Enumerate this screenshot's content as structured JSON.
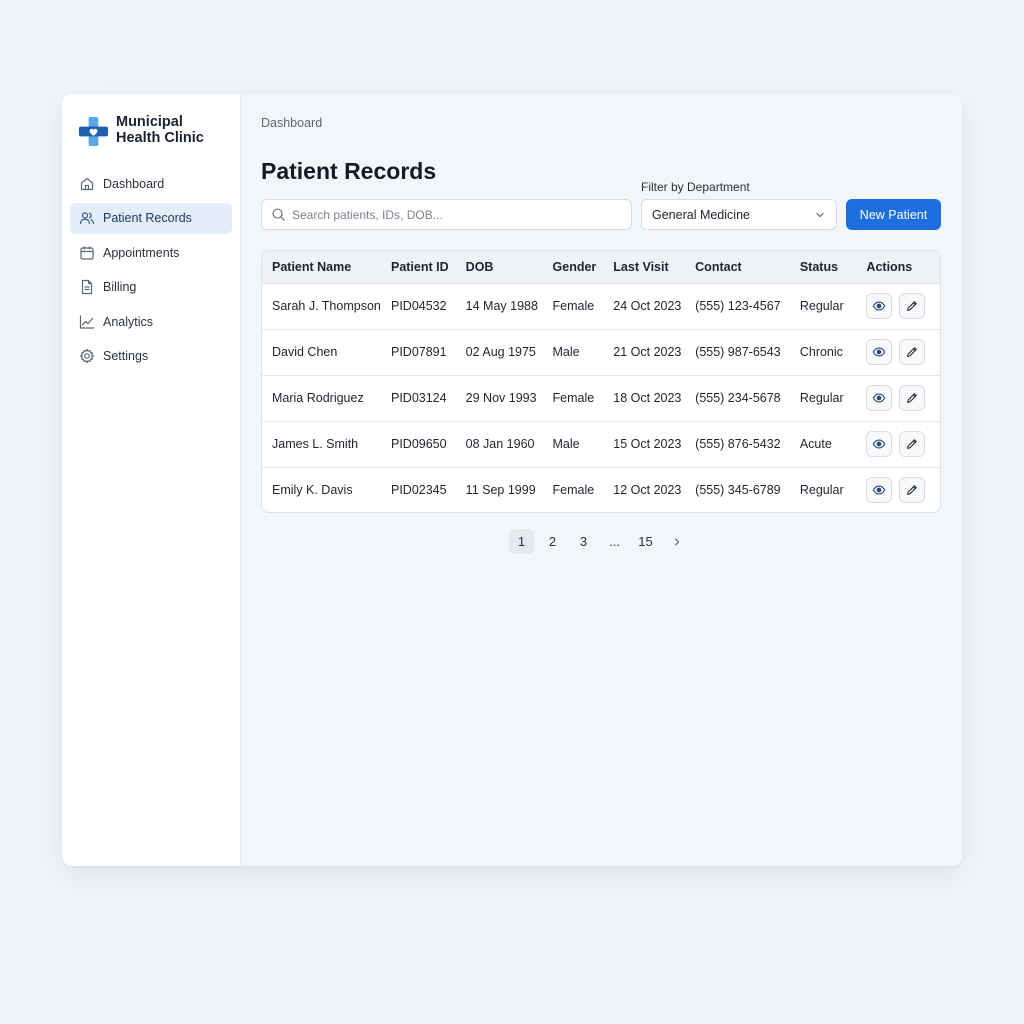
{
  "brand": {
    "name_line1": "Municipal",
    "name_line2": "Health Clinic"
  },
  "sidebar": {
    "items": [
      {
        "label": "Dashboard",
        "icon": "home-icon"
      },
      {
        "label": "Patient Records",
        "icon": "users-icon",
        "active": true
      },
      {
        "label": "Appointments",
        "icon": "calendar-icon"
      },
      {
        "label": "Billing",
        "icon": "document-icon"
      },
      {
        "label": "Analytics",
        "icon": "chart-line-icon"
      },
      {
        "label": "Settings",
        "icon": "gear-icon"
      }
    ]
  },
  "main": {
    "breadcrumb": "Dashboard",
    "title": "Patient Records",
    "search": {
      "placeholder": "Search patients, IDs, DOB...",
      "value": ""
    },
    "filter": {
      "label": "Filter by Department",
      "selected": "General Medicine"
    },
    "new_button": "New Patient"
  },
  "table": {
    "columns": [
      "Patient Name",
      "Patient ID",
      "DOB",
      "Gender",
      "Last Visit",
      "Contact",
      "Status",
      "Actions"
    ],
    "rows": [
      {
        "name": "Sarah J. Thompson",
        "id": "PID04532",
        "dob": "14 May 1988",
        "gender": "Female",
        "last_visit": "24 Oct 2023",
        "contact": "(555) 123-4567",
        "status": "Regular"
      },
      {
        "name": "David Chen",
        "id": "PID07891",
        "dob": "02 Aug 1975",
        "gender": "Male",
        "last_visit": "21 Oct 2023",
        "contact": "(555) 987-6543",
        "status": "Chronic"
      },
      {
        "name": "Maria Rodriguez",
        "id": "PID03124",
        "dob": "29 Nov 1993",
        "gender": "Female",
        "last_visit": "18 Oct 2023",
        "contact": "(555) 234-5678",
        "status": "Regular"
      },
      {
        "name": "James L. Smith",
        "id": "PID09650",
        "dob": "08 Jan 1960",
        "gender": "Male",
        "last_visit": "15 Oct 2023",
        "contact": "(555) 876-5432",
        "status": "Acute"
      },
      {
        "name": "Emily K. Davis",
        "id": "PID02345",
        "dob": "11 Sep 1999",
        "gender": "Female",
        "last_visit": "12 Oct 2023",
        "contact": "(555) 345-6789",
        "status": "Regular"
      }
    ]
  },
  "pagination": {
    "pages": [
      "1",
      "2",
      "3",
      "...",
      "15"
    ],
    "current": "1"
  },
  "colors": {
    "accent": "#1d6fe0",
    "active_nav_bg": "#e4eefb",
    "logo_dark": "#1f5fb0",
    "logo_light": "#5aa8e6"
  }
}
